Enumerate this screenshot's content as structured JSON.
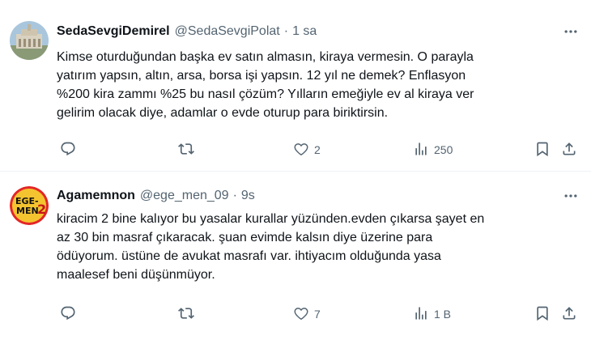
{
  "tweets": [
    {
      "display_name": "SedaSevgiDemirel",
      "handle": "@SedaSevgiPolat",
      "separator": "·",
      "time": "1 sa",
      "text": "Kimse oturduğundan başka ev satın almasın, kiraya vermesin. O parayla\nyatırım yapsın, altın, arsa, borsa işi yapsın. 12 yıl ne demek? Enflasyon\n%200 kira zammı %25 bu nasıl çözüm? Yılların emeğiyle ev al kiraya ver\ngelirim olacak diye, adamlar o evde oturup para biriktirsin.",
      "replies": "",
      "retweets": "",
      "likes": "2",
      "views": "250"
    },
    {
      "display_name": "Agamemnon",
      "handle": "@ege_men_09",
      "separator": "·",
      "time": "9s",
      "text": "kiracim 2 bine kalıyor bu yasalar kurallar yüzünden.evden çıkarsa şayet en\naz 30 bin masraf çıkaracak. şuan evimde kalsın diye üzerine para\nödüyorum. üstüne de avukat masrafı var. ihtiyacım olduğunda yasa\nmaalesef beni düşünmüyor.",
      "replies": "",
      "retweets": "",
      "likes": "7",
      "views": "1 B",
      "avatar_logo_text": "EGE-MEN 2"
    }
  ],
  "icons": [
    "more-icon",
    "reply-icon",
    "retweet-icon",
    "like-icon",
    "views-icon",
    "bookmark-icon",
    "share-icon"
  ],
  "colors": {
    "text": "#0f1419",
    "secondary": "#536471",
    "divider": "#eff3f4"
  }
}
